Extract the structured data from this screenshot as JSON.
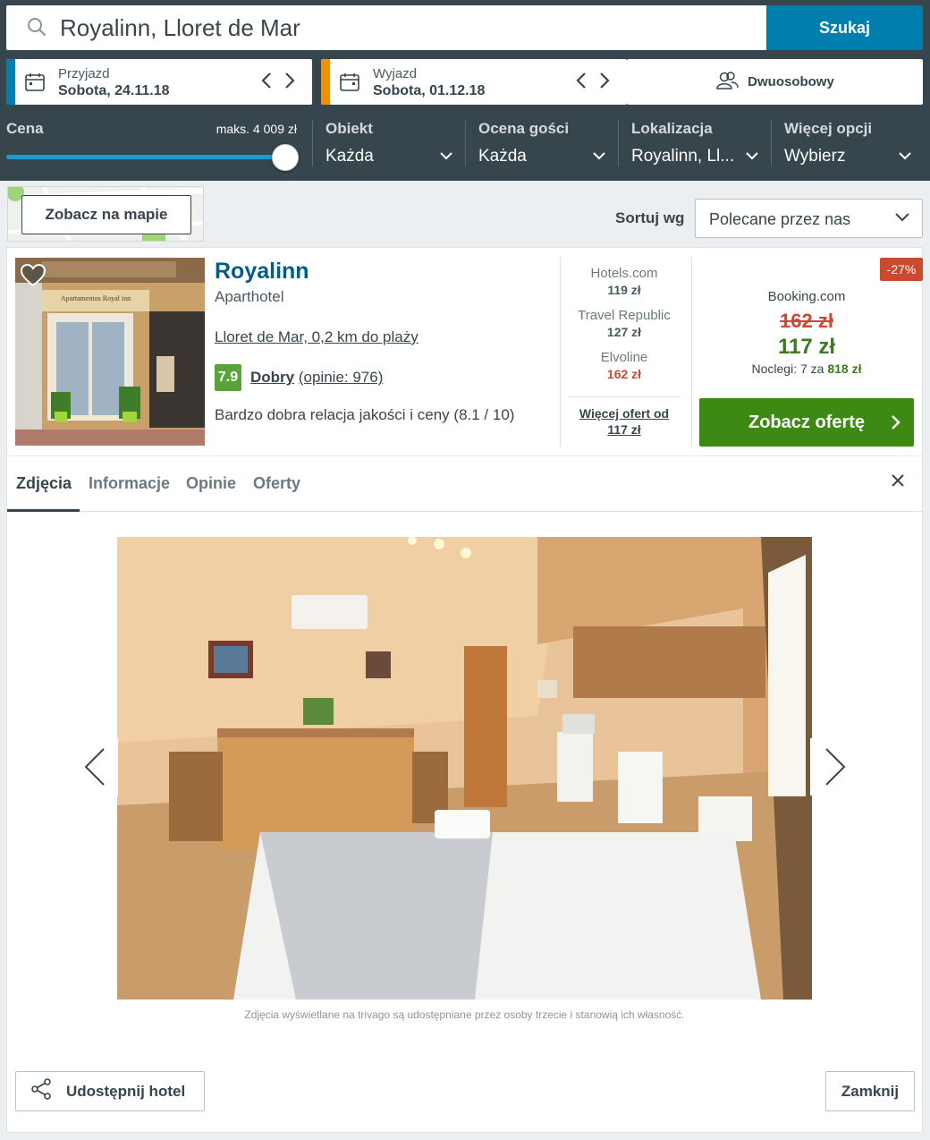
{
  "search": {
    "value": "Royalinn, Lloret de Mar",
    "button": "Szukaj"
  },
  "checkin": {
    "label": "Przyjazd",
    "value": "Sobota, 24.11.18"
  },
  "checkout": {
    "label": "Wyjazd",
    "value": "Sobota, 01.12.18"
  },
  "room": {
    "label": "Dwuosobowy"
  },
  "filters": {
    "price": {
      "label": "Cena",
      "max": "maks. 4 009 zł",
      "level": 1.0
    },
    "items": [
      {
        "label": "Obiekt",
        "value": "Każda"
      },
      {
        "label": "Ocena gości",
        "value": "Każda"
      },
      {
        "label": "Lokalizacja",
        "value": "Royalinn, Ll..."
      },
      {
        "label": "Więcej opcji",
        "value": "Wybierz"
      }
    ]
  },
  "map": {
    "button": "Zobacz na mapie"
  },
  "sort": {
    "label": "Sortuj wg",
    "value": "Polecane przez nas"
  },
  "hotel": {
    "name": "Royalinn",
    "type": "Aparthotel",
    "location": "Lloret de Mar, 0,2 km do plaży",
    "score": "7.9",
    "rating_word": "Dobry",
    "reviews": "(opinie: 976)",
    "value_note": "Bardzo dobra relacja jakości i ceny (8.1 / 10)",
    "sign_text": "Apartamentos Royal inn"
  },
  "partners": [
    {
      "name": "Hotels.com",
      "price": "119 zł"
    },
    {
      "name": "Travel Republic",
      "price": "127 zł"
    },
    {
      "name": "Elvoline",
      "price": "162 zł"
    }
  ],
  "more_offers": {
    "line1": "Więcej ofert od",
    "line2": "117 zł"
  },
  "deal": {
    "discount": "-27%",
    "provider": "Booking.com",
    "old_price": "162 zł",
    "price": "117 zł",
    "nights_label": "Noclegi: 7 za",
    "nights_total": "818 zł",
    "button": "Zobacz ofertę"
  },
  "tabs": [
    "Zdjęcia",
    "Informacje",
    "Opinie",
    "Oferty"
  ],
  "photo_credit": "Zdjęcia wyświetlane na trivago są udostępniane przez osoby trzecie i stanowią ich własność.",
  "buttons": {
    "share": "Udostępnij hotel",
    "close": "Zamknij"
  },
  "colors": {
    "topbar": "#37454d",
    "search_button": "#007faf",
    "cta": "#3c8a14",
    "discount": "#c94a30",
    "checkin_stripe": "#007faf",
    "checkout_stripe": "#f48f00"
  }
}
